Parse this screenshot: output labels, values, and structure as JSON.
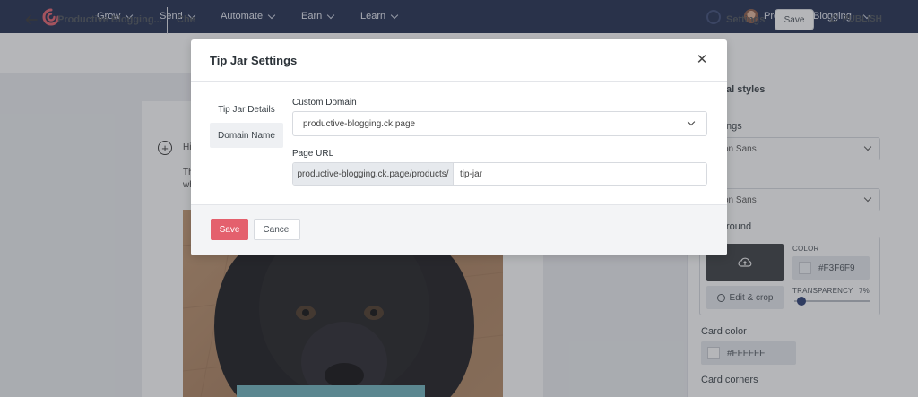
{
  "nav": {
    "items": [
      {
        "label": "Grow"
      },
      {
        "label": "Send"
      },
      {
        "label": "Automate"
      },
      {
        "label": "Earn"
      },
      {
        "label": "Learn"
      }
    ],
    "account_name": "Productive Blogging"
  },
  "subbar": {
    "doc_title": "Productive Blogging...",
    "doc_title_2": "Che",
    "settings_label": "Settings",
    "save_label": "Save",
    "publish_label": "PUBLISH"
  },
  "canvas": {
    "frag_1": "Hi",
    "frag_2": "Th",
    "frag_3": "wh"
  },
  "sidebar": {
    "heading": "al styles",
    "label_1": "ngs",
    "font_1": "on Sans",
    "font_2": "on Sans",
    "background_label": "round",
    "color_caption": "COLOR",
    "color_value": "#F3F6F9",
    "transparency_caption": "TRANSPARENCY",
    "transparency_value": "7%",
    "edit_crop_label": "Edit & crop",
    "card_color_label": "Card color",
    "card_color_value": "#FFFFFF",
    "card_corners_label": "Card corners"
  },
  "modal": {
    "title": "Tip Jar Settings",
    "tabs": [
      {
        "label": "Tip Jar Details"
      },
      {
        "label": "Domain Name"
      }
    ],
    "custom_domain_label": "Custom Domain",
    "custom_domain_value": "productive-blogging.ck.page",
    "page_url_label": "Page URL",
    "url_prefix": "productive-blogging.ck.page/products/",
    "url_slug": "tip-jar",
    "save_label": "Save",
    "cancel_label": "Cancel"
  },
  "colors": {
    "nav_bg": "#1d2a4d",
    "save_btn": "#e4606d",
    "brand_logo": "#e4606d"
  }
}
